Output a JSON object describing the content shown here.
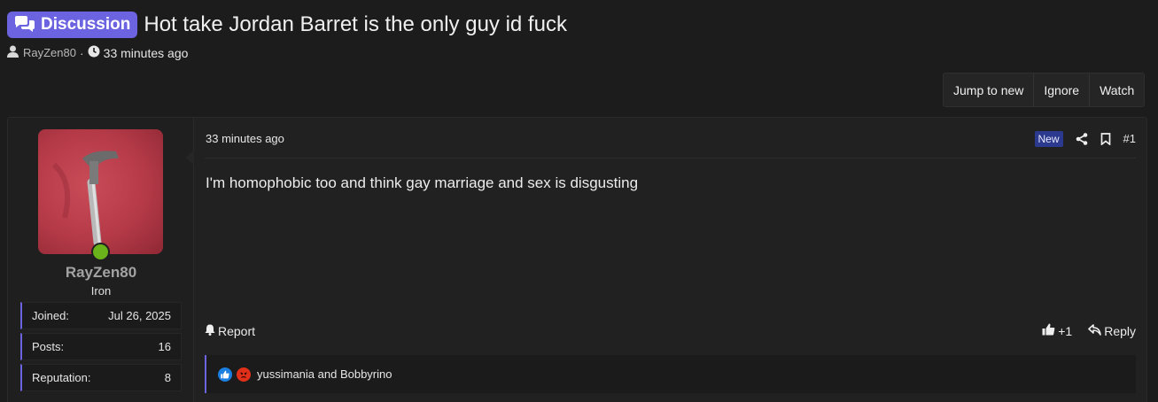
{
  "thread": {
    "prefix": "Discussion",
    "title": "Hot take Jordan Barret is the only guy id fuck",
    "author": "RayZen80",
    "separator": "·",
    "time": "33 minutes ago"
  },
  "actions": {
    "jump_to_new": "Jump to new",
    "ignore": "Ignore",
    "watch": "Watch"
  },
  "post": {
    "user": {
      "name": "RayZen80",
      "title": "Iron",
      "stats": [
        {
          "label": "Joined:",
          "value": "Jul 26, 2025"
        },
        {
          "label": "Posts:",
          "value": "16"
        },
        {
          "label": "Reputation:",
          "value": "8"
        }
      ]
    },
    "time": "33 minutes ago",
    "badge": "New",
    "number": "#1",
    "body": "I'm homophobic too and think gay marriage and sex is disgusting",
    "report_label": "Report",
    "like_label": "+1",
    "reply_label": "Reply",
    "reactions_text": "yussimania and Bobbyrino"
  },
  "colors": {
    "accent": "#6c63e0",
    "online": "#6ab31a",
    "new_badge": "#2b3a8f",
    "like_reaction": "#1a7fe0",
    "angry_reaction": "#e0301a"
  },
  "icons": {
    "prefix": "chat-bubbles-icon",
    "author": "user-icon",
    "time": "clock-icon",
    "share": "share-icon",
    "bookmark": "bookmark-icon",
    "report": "bell-icon",
    "like": "thumbs-up-icon",
    "reply": "reply-icon",
    "reaction_like": "like-reaction-icon",
    "reaction_angry": "angry-reaction-icon"
  }
}
